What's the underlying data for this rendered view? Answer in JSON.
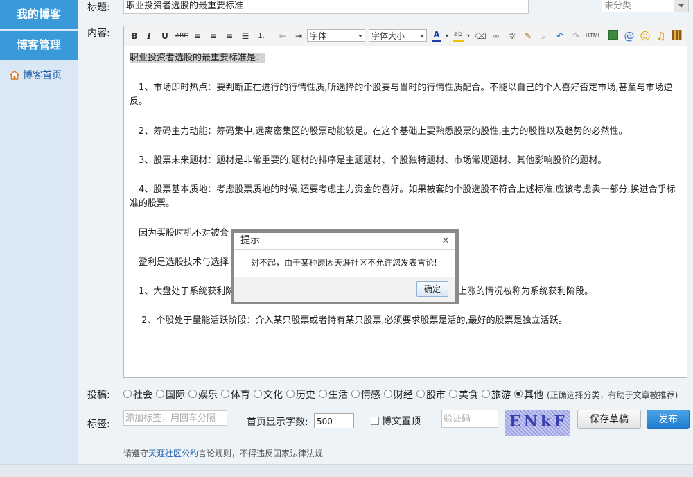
{
  "sidebar": {
    "my_blog": "我的博客",
    "blog_manage": "博客管理",
    "blog_home": "博客首页"
  },
  "form": {
    "title_label": "标题:",
    "title_value": "职业投资者选股的最重要标准",
    "category_value": "未分类",
    "content_label": "内容:",
    "submit_label": "投稿:",
    "tags_label": "标签:",
    "tags_placeholder": "添加标签，用回车分隔",
    "home_chars_label": "首页显示字数:",
    "home_chars_value": "500",
    "pin_label": "博文置顶",
    "captcha_placeholder": "验证码",
    "captcha_text": "ENkF",
    "save_draft": "保存草稿",
    "publish": "发布",
    "footer_prefix": "请遵守",
    "footer_link": "天涯社区公约",
    "footer_suffix": "言论规则，不得违反国家法律法规"
  },
  "toolbar": {
    "font_select": "字体",
    "size_select": "字体大小",
    "html_label": "HTML"
  },
  "categories": {
    "items": [
      "社会",
      "国际",
      "娱乐",
      "体育",
      "文化",
      "历史",
      "生活",
      "情感",
      "财经",
      "股市",
      "美食",
      "旅游",
      "其他"
    ],
    "selected": "其他",
    "hint": "(正确选择分类，有助于文章被推荐)"
  },
  "content": {
    "p0": "职业投资者选股的最重要标准是：",
    "p1": "　1、市场即时热点：要判断正在进行的行情性质,所选择的个股要与当时的行情性质配合。不能以自己的个人喜好否定市场,甚至与市场逆反。",
    "p2": "　2、筹码主力动能：筹码集中,远离密集区的股票动能较足。在这个基础上要熟悉股票的股性,主力的股性以及趋势的必然性。",
    "p3": "　3、股票未来题材：题材是非常重要的,题材的排序是主题题材、个股独特题材、市场常规题材、其他影响股价的题材。",
    "p4": "　4、股票基本质地：考虑股票质地的时候,还要考虑主力资金的喜好。如果被套的个股选股不符合上述标准,应该考虑卖一部分,换进合乎标准的股票。",
    "p5": "　因为买股时机不对被套",
    "p6": "　盈利是选股技术与选择",
    "p7a": "　1、大盘处于系统获利阶",
    "p7b": "上涨的情况被称为系统获利阶段。",
    "p8": "　 2、个股处于量能活跃阶段：介入某只股票或者持有某只股票,必须要求股票是活的,最好的股票是独立活跃。"
  },
  "modal": {
    "title": "提示",
    "close": "×",
    "message": "对不起，由于某种原因天涯社区不允许您发表言论!",
    "ok": "确定"
  }
}
